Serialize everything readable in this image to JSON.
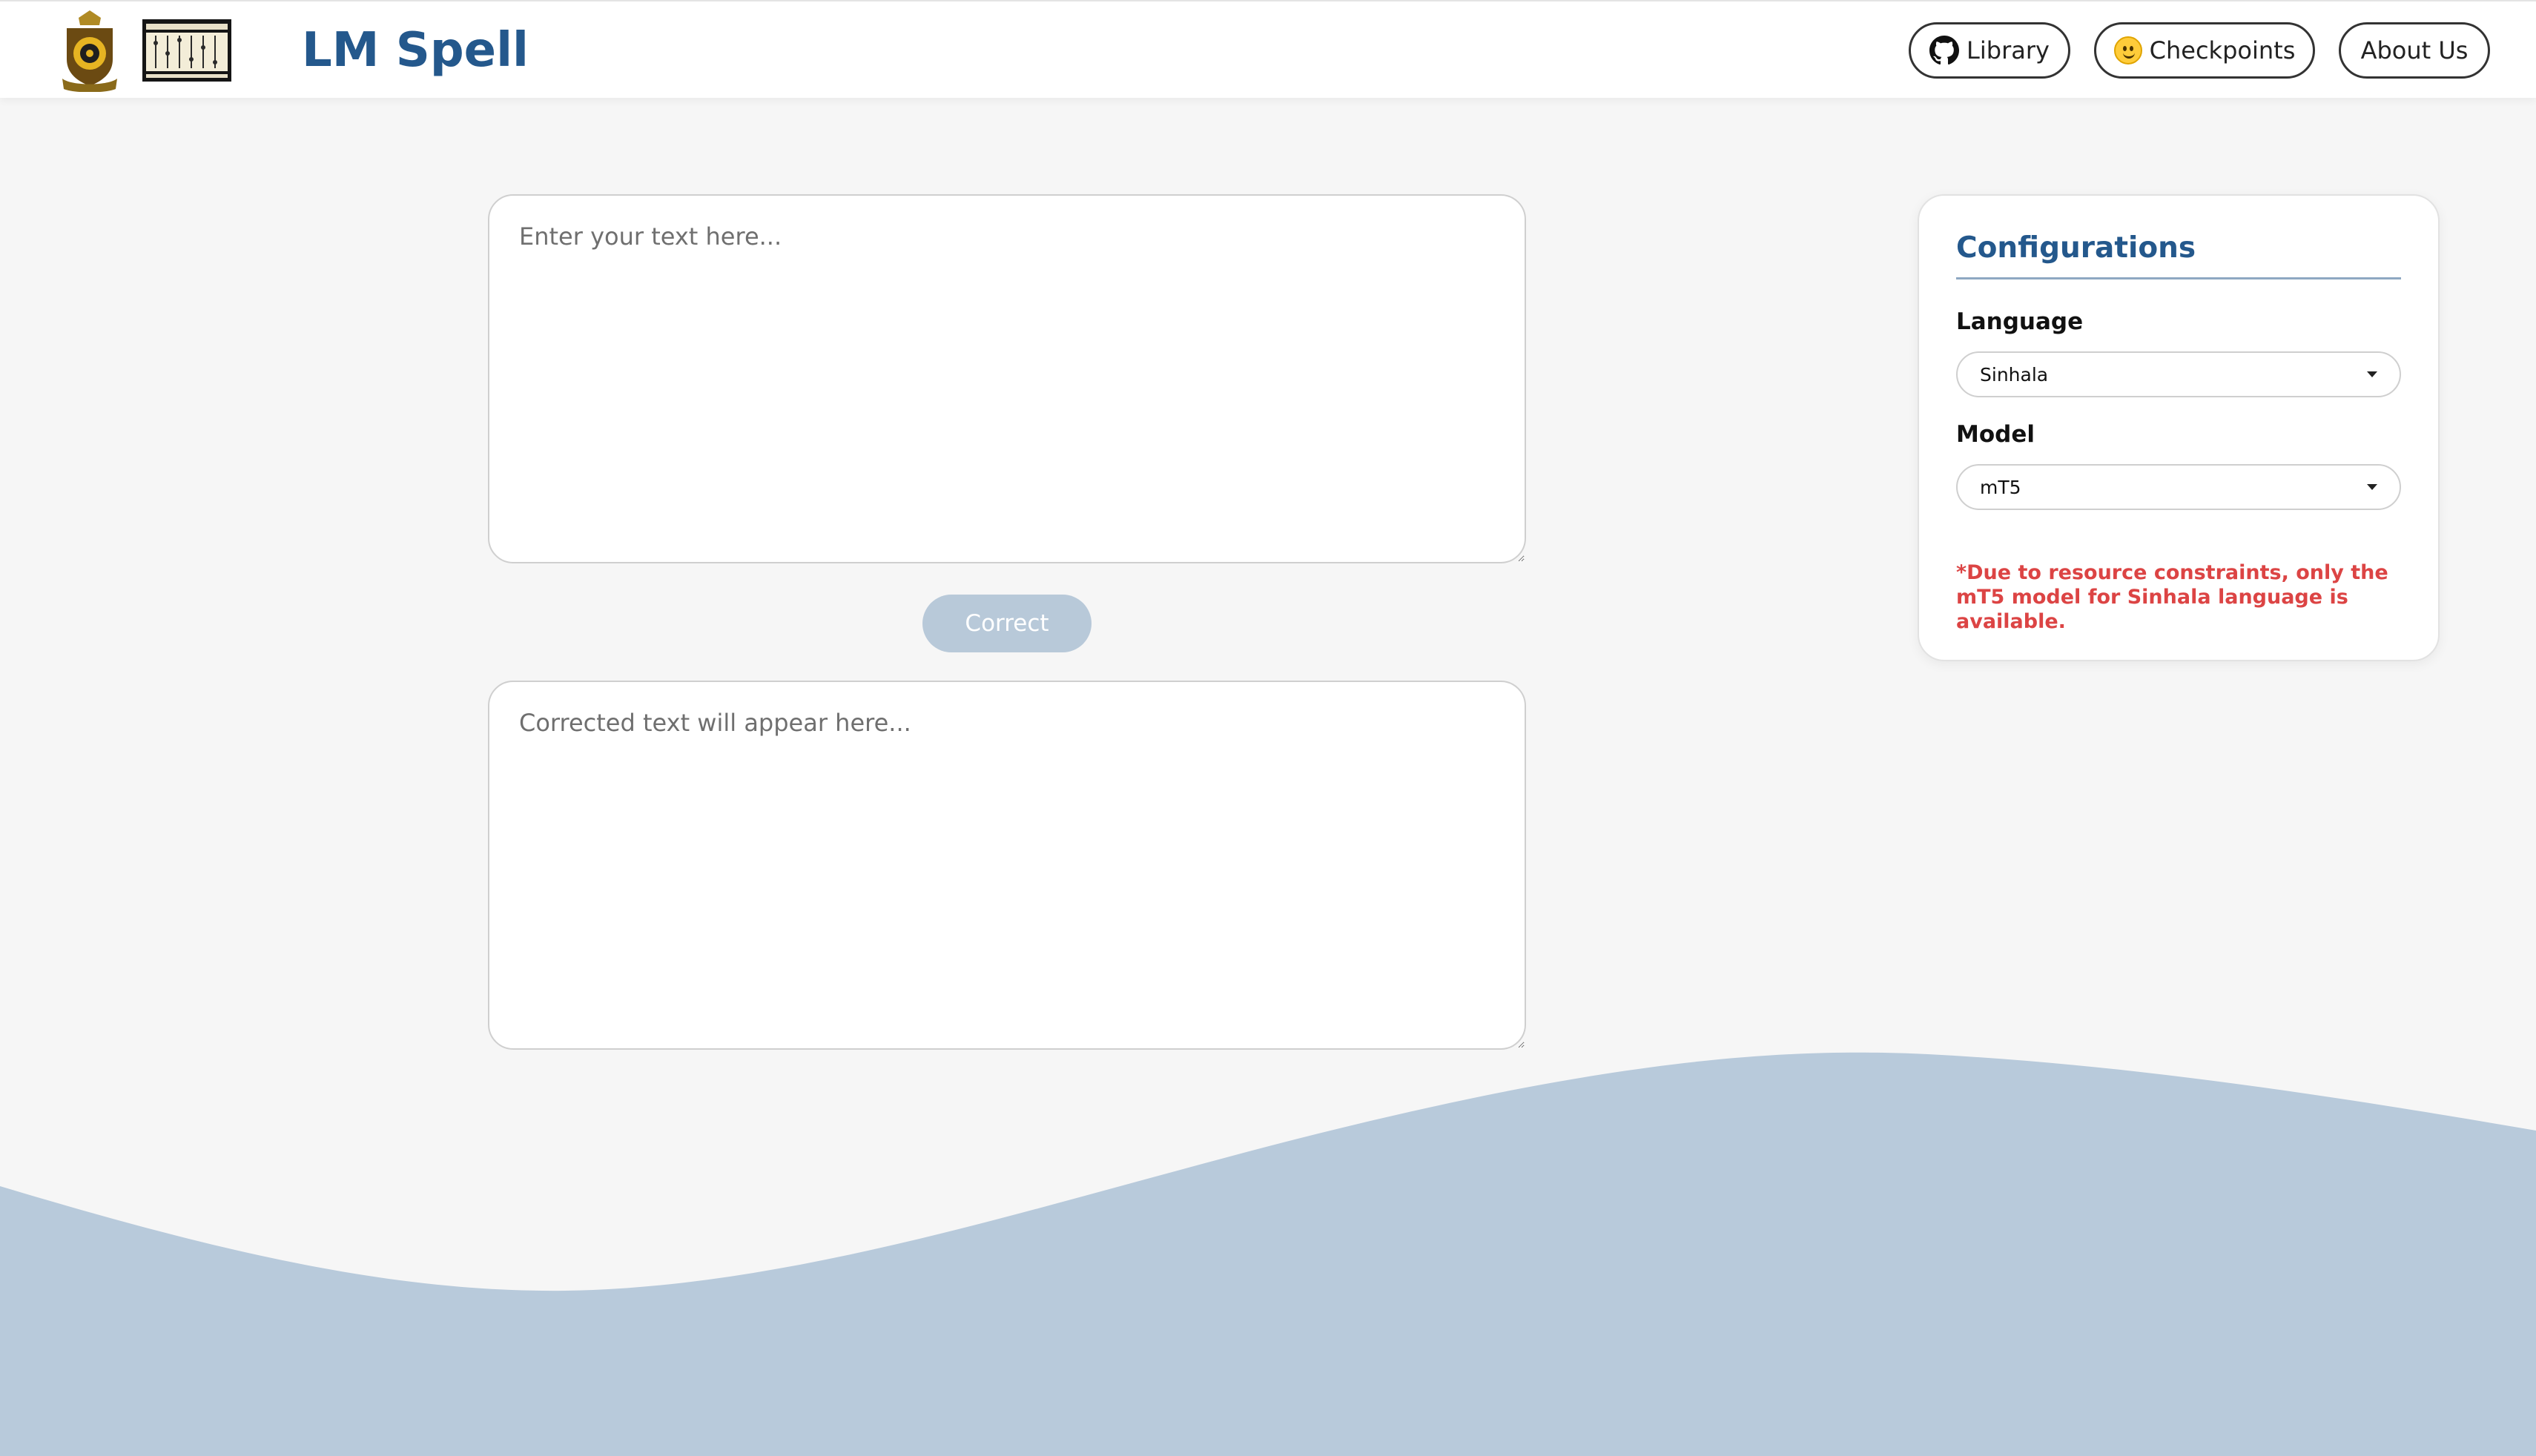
{
  "app": {
    "title": "LM Spell"
  },
  "nav": {
    "library_label": "Library",
    "library_icon": "github-icon",
    "checkpoints_label": "Checkpoints",
    "checkpoints_icon": "huggingface-icon",
    "about_label": "About Us"
  },
  "editor": {
    "input_placeholder": "Enter your text here...",
    "output_placeholder": "Corrected text will appear here...",
    "correct_label": "Correct"
  },
  "config": {
    "title": "Configurations",
    "language_label": "Language",
    "language_value": "Sinhala",
    "model_label": "Model",
    "model_value": "mT5",
    "note": "*Due to resource constraints, only the mT5 model for Sinhala language is available."
  },
  "colors": {
    "brand": "#24588c",
    "wave": "#b8cadb",
    "background": "#f6f6f6",
    "warning": "#dc4444",
    "button_disabled": "#b8c9d9"
  }
}
